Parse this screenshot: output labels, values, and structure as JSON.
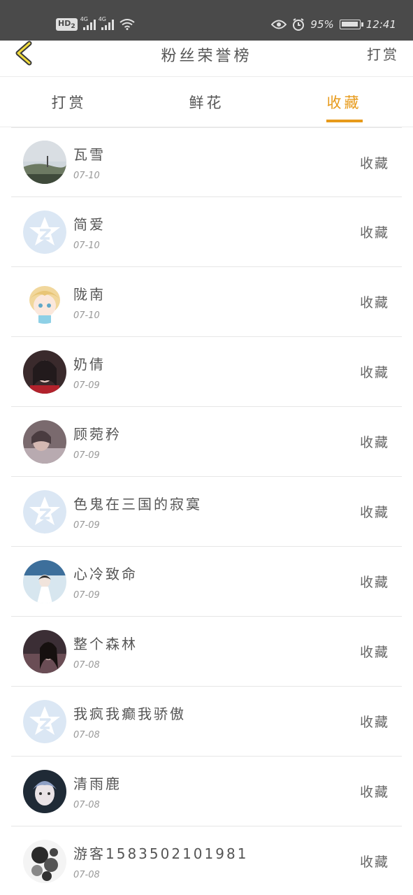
{
  "status_bar": {
    "hd": "HD",
    "hd_sub": "2",
    "net1": "4G",
    "net2": "4G",
    "battery": "95%",
    "time": "12:41"
  },
  "header": {
    "title": "粉丝荣誉榜",
    "right_action": "打赏"
  },
  "tabs": [
    {
      "label": "打赏",
      "active": false
    },
    {
      "label": "鲜花",
      "active": false
    },
    {
      "label": "收藏",
      "active": true
    }
  ],
  "colors": {
    "accent": "#e79a1a",
    "default_avatar": "#dbe7f4"
  },
  "items": [
    {
      "name": "瓦雪",
      "date": "07-10",
      "action": "收藏",
      "avatar": "photo-landscape"
    },
    {
      "name": "简爱",
      "date": "07-10",
      "action": "收藏",
      "avatar": "default-qq"
    },
    {
      "name": "陇南",
      "date": "07-10",
      "action": "收藏",
      "avatar": "anime-boy"
    },
    {
      "name": "奶倩",
      "date": "07-09",
      "action": "收藏",
      "avatar": "photo-girl"
    },
    {
      "name": "顾菀矜",
      "date": "07-09",
      "action": "收藏",
      "avatar": "photo-person"
    },
    {
      "name": "色鬼在三国的寂寞",
      "date": "07-09",
      "action": "收藏",
      "avatar": "default-qq"
    },
    {
      "name": "心冷致命",
      "date": "07-09",
      "action": "收藏",
      "avatar": "photo-sky"
    },
    {
      "name": "整个森林",
      "date": "07-08",
      "action": "收藏",
      "avatar": "photo-girl-dark"
    },
    {
      "name": "我疯我癫我骄傲",
      "date": "07-08",
      "action": "收藏",
      "avatar": "default-qq"
    },
    {
      "name": "清雨鹿",
      "date": "07-08",
      "action": "收藏",
      "avatar": "photo-boy"
    },
    {
      "name": "游客1583502101981",
      "date": "07-08",
      "action": "收藏",
      "avatar": "photo-ink"
    }
  ]
}
